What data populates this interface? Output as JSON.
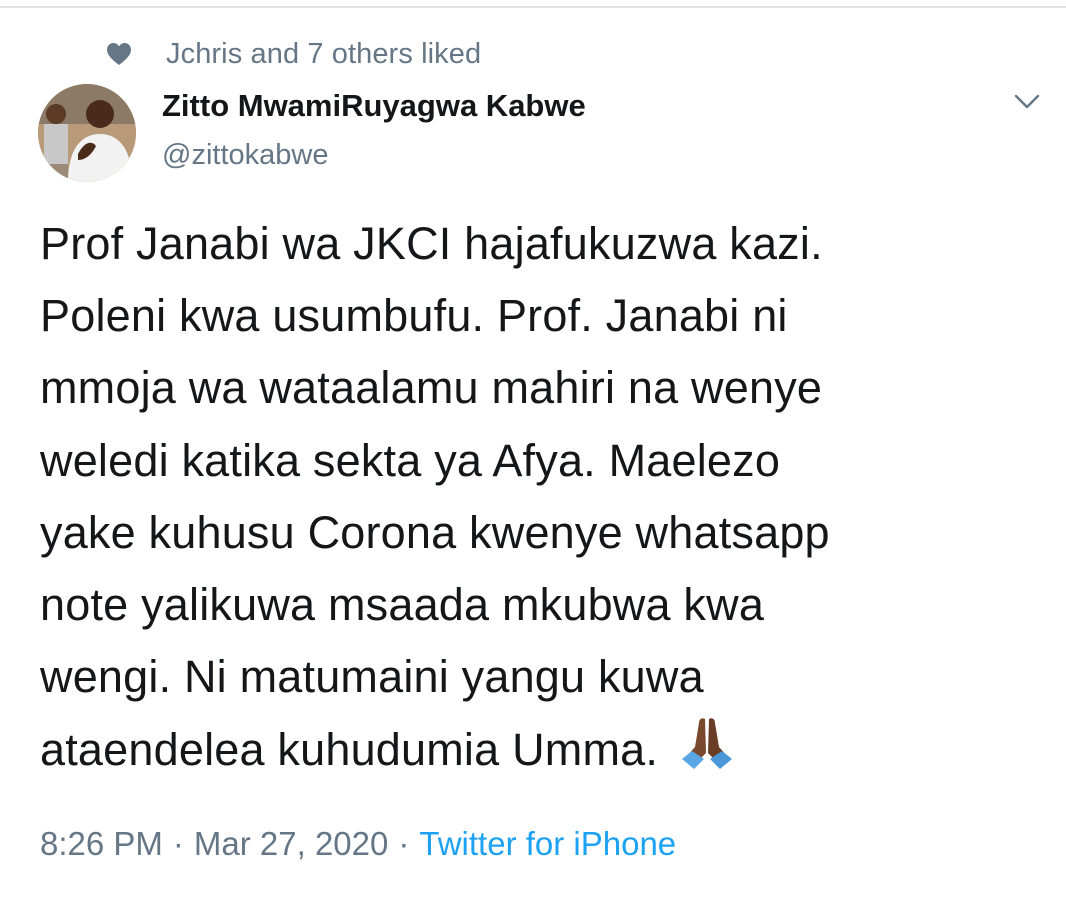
{
  "social_context": {
    "icon": "heart-icon",
    "text": "Jchris and 7 others liked"
  },
  "author": {
    "display_name": "Zitto MwamiRuyagwa Kabwe",
    "handle": "@zittokabwe"
  },
  "tweet": {
    "text": "Prof Janabi wa JKCI hajafukuzwa kazi.\nPoleni kwa usumbufu. Prof. Janabi ni\nmmoja wa wataalamu mahiri na wenye\nweledi katika sekta ya Afya. Maelezo\nyake kuhusu Corona kwenye whatsapp\nnote yalikuwa msaada mkubwa kwa\nwengi. Ni matumaini yangu kuwa\nataendelea kuhudumia Umma.",
    "emoji": "folded-hands-icon"
  },
  "meta": {
    "time": "8:26 PM",
    "separator": "·",
    "date": "Mar 27, 2020",
    "source": "Twitter for iPhone"
  },
  "colors": {
    "text_primary": "#14171a",
    "text_secondary": "#657786",
    "link": "#1da1f2",
    "divider": "#dfe3e8"
  }
}
